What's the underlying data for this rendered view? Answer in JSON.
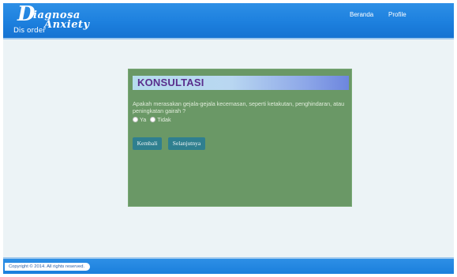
{
  "header": {
    "logo": {
      "glyph": "D",
      "line1": "iagnosa",
      "line2": "Anxiety",
      "line3": "Dis order"
    },
    "nav": [
      "Beranda",
      "Profile"
    ]
  },
  "panel": {
    "title": "KONSULTASI",
    "question": "Apakah merasakan gejala-gejala kecemasan, seperti ketakutan, penghindaran, atau peningkatan gairah ?",
    "options": [
      "Ya",
      "Tidak"
    ],
    "buttons": {
      "back": "Kembali",
      "next": "Selanjutnya"
    }
  },
  "footer": {
    "copyright": "Copyright © 2014. All rights reserved."
  },
  "colors": {
    "header_blue": "#1d80de",
    "panel_green": "#6a9866",
    "button_teal": "#2f7f8f",
    "title_purple": "#5a2e8c",
    "page_background": "#ecf3f6"
  }
}
